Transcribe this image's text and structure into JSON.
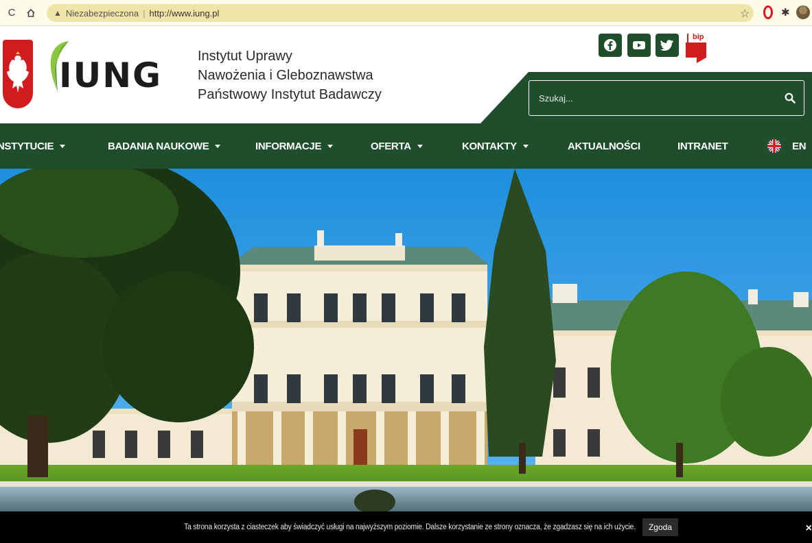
{
  "browser": {
    "security_label": "Niezabezpieczona",
    "url": "http://www.iung.pl"
  },
  "header": {
    "logo_text": "IUNG",
    "institute_lines": [
      "Instytut Uprawy",
      "Nawożenia i Gleboznawstwa",
      "Państwowy Instytut Badawczy"
    ],
    "social": [
      "facebook-icon",
      "youtube-icon",
      "twitter-icon"
    ],
    "bip_label": "bip",
    "search_placeholder": "Szukaj..."
  },
  "nav": {
    "items": [
      {
        "label": "INSTYTUCIE",
        "dropdown": true
      },
      {
        "label": "BADANIA NAUKOWE",
        "dropdown": true
      },
      {
        "label": "INFORMACJE",
        "dropdown": true
      },
      {
        "label": "OFERTA",
        "dropdown": true
      },
      {
        "label": "KONTAKTY",
        "dropdown": true
      },
      {
        "label": "AKTUALNOŚCI",
        "dropdown": false
      },
      {
        "label": "INTRANET",
        "dropdown": false
      }
    ],
    "language": "EN"
  },
  "cookie": {
    "text": "Ta strona korzysta z ciasteczek aby świadczyć usługi na najwyższym poziomie. Dalsze korzystanie ze strony oznacza, że zgadzasz się na ich użycie.",
    "accept_label": "Zgoda",
    "close_label": "×"
  },
  "colors": {
    "brand_green": "#1f4e2c",
    "address_bar": "#efe5a8",
    "emblem_red": "#d01c1f"
  }
}
